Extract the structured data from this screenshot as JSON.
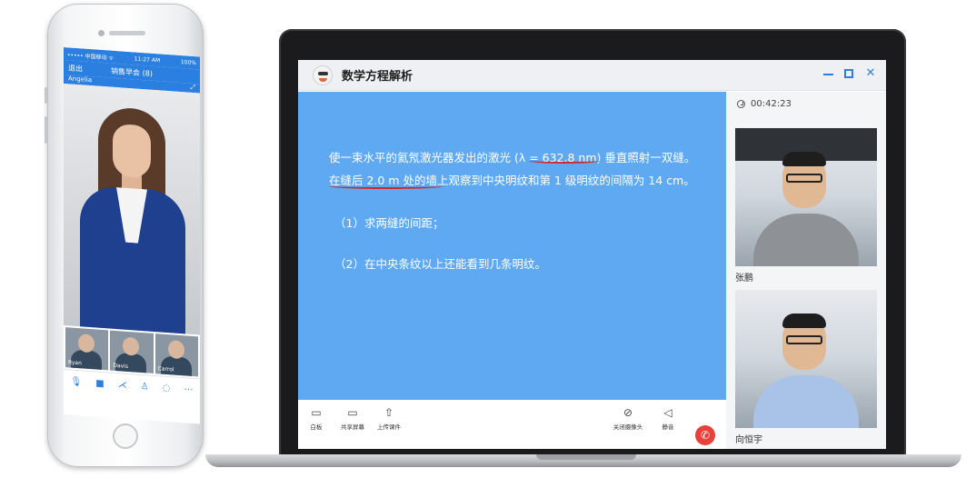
{
  "phone": {
    "status_left": "••••• 中国移动 ᯤ",
    "status_time": "11:27 AM",
    "status_right": "100%",
    "nav_back": "退出",
    "nav_title": "销售早会 (8)",
    "presenter": "Angelia",
    "thumbs": [
      "Ryan",
      "Davis",
      "Carrol"
    ],
    "bar_icons": [
      "mic-icon",
      "camera-icon",
      "share-icon",
      "user-icon",
      "chat-icon",
      "more-icon"
    ]
  },
  "app": {
    "title": "数学方程解析",
    "window_controls": [
      "minimize",
      "maximize",
      "close"
    ],
    "question": {
      "line1": "使一束水平的氦氖激光器发出的激光 (λ = 632.8 nm) 垂直照射一双缝。",
      "line2": "在缝后 2.0 m 处的墙上观察到中央明纹和第 1 级明纹的间隔为 14 cm。",
      "part1": "（1）求两缝的间距；",
      "part2": "（2）在中央条纹以上还能看到几条明纹。"
    },
    "timer": "00:42:23",
    "participants": [
      {
        "name": "张鹏",
        "shirt_color": "#8e9196"
      },
      {
        "name": "向恒宇",
        "shirt_color": "#a9c3e8"
      }
    ],
    "toolbar": {
      "whiteboard": "白板",
      "share_screen": "共享屏幕",
      "upload": "上传课件",
      "camera_off": "关闭摄像头",
      "mute": "静音"
    },
    "colors": {
      "accent": "#2b7fe0",
      "board": "#5fa9f2",
      "annotation": "#d3262b",
      "hangup": "#e8403a"
    }
  }
}
